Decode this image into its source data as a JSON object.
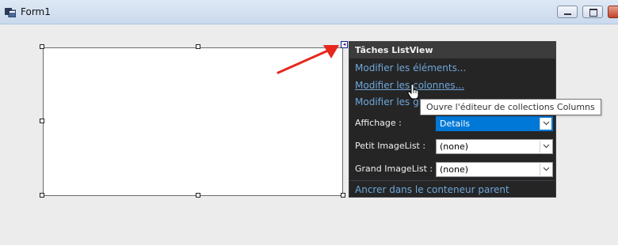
{
  "window": {
    "title": "Form1",
    "icon": "form-icon",
    "buttons": [
      "minimize-icon",
      "maximize-icon",
      "close-icon"
    ]
  },
  "designer": {
    "control": "listview",
    "smart_tag_glyph": "◂"
  },
  "smart_tag_panel": {
    "title": "Tâches ListView",
    "links": {
      "edit_items": "Modifier les éléments...",
      "edit_columns": "Modifier les colonnes...",
      "edit_groups": "Modifier les groupes...",
      "dock": "Ancrer dans le conteneur parent"
    },
    "properties": {
      "view_label": "Affichage :",
      "view_value": "Details",
      "small_imagelist_label": "Petit ImageList :",
      "small_imagelist_value": "(none)",
      "large_imagelist_label": "Grand ImageList :",
      "large_imagelist_value": "(none)"
    },
    "hovered_link": "edit_columns"
  },
  "tooltip": {
    "text": "Ouvre l'éditeur de collections Columns"
  },
  "colors": {
    "panel_bg": "#252526",
    "panel_header_bg": "#3c3c3c",
    "link": "#6fa7d8",
    "selection": "#0078d7",
    "arrow": "#e8271c"
  }
}
